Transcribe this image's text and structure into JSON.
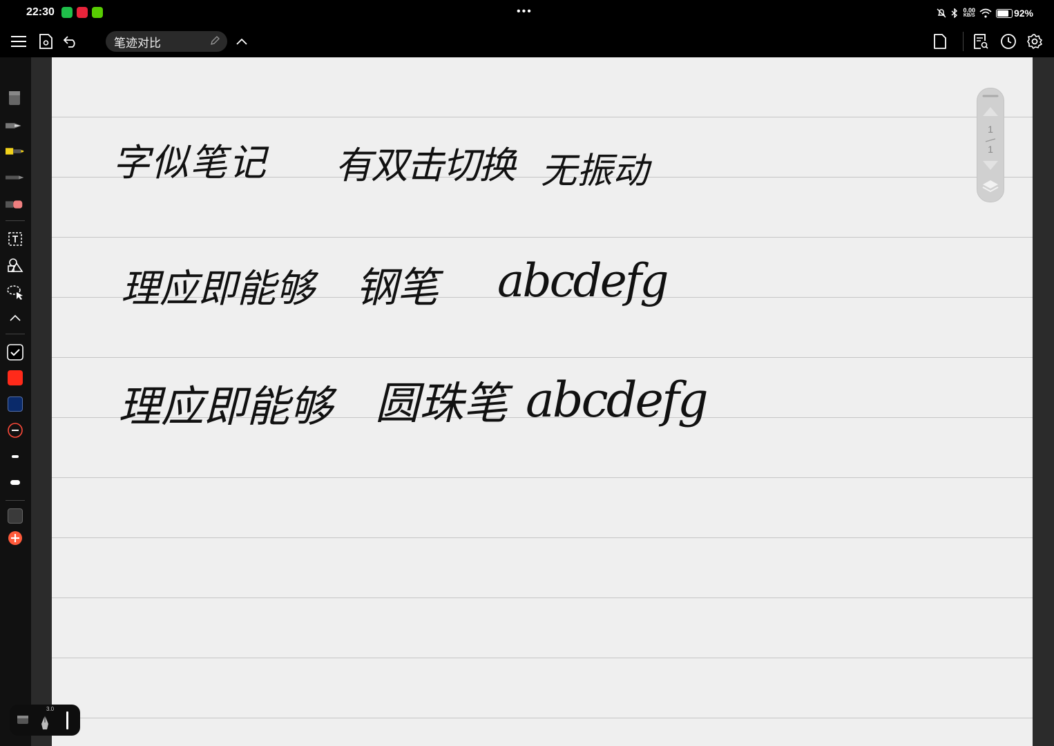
{
  "status_bar": {
    "time": "22:30",
    "apps": [
      "wechat-icon",
      "redbook-icon",
      "duolingo-icon"
    ],
    "more": "•••",
    "net_speed_value": "0.00",
    "net_speed_unit": "KB/S",
    "battery": "92%",
    "battery_level": 0.92
  },
  "toolbar": {
    "title": "笔迹对比",
    "icons": [
      "menu-icon",
      "reading-mode-icon",
      "undo-icon",
      "edit-icon",
      "chevron-up-icon",
      "page-icon",
      "search-notes-icon",
      "history-icon",
      "settings-icon"
    ]
  },
  "sidebar": {
    "tools": [
      "eraser-tool",
      "fountain-pen-tool",
      "highlighter-tool",
      "pencil-tool",
      "eraser-pen-tool",
      "text-tool",
      "shapes-tool",
      "lasso-tool",
      "collapse-tool"
    ],
    "colors": {
      "red": "#ff2a1a",
      "navy": "#0a2a6a",
      "gray": "#3a3a3a",
      "add": "#ff5a3a"
    }
  },
  "canvas": {
    "lines": [
      [
        "字似笔记",
        "有双击切换",
        "无振动"
      ],
      [
        "理应即能够",
        "钢笔",
        "abcdefg"
      ],
      [
        "理应即能够",
        "圆珠笔",
        "abcdefg"
      ]
    ]
  },
  "pager": {
    "current": "1",
    "total": "1"
  },
  "pen_panel": {
    "size": "3.0"
  }
}
